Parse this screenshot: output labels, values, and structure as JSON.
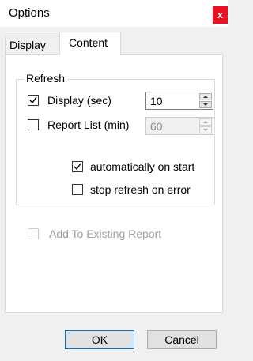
{
  "window": {
    "title": "Options",
    "close_glyph": "x"
  },
  "tabs": [
    {
      "label": "Display",
      "selected": false
    },
    {
      "label": "Content",
      "selected": true
    }
  ],
  "refresh": {
    "group_label": "Refresh",
    "display": {
      "label": "Display (sec)",
      "checked": true,
      "value": "10"
    },
    "report_list": {
      "label": "Report List (min)",
      "checked": false,
      "value": "60",
      "disabled": true
    },
    "auto_start": {
      "label": "automatically on start",
      "checked": true
    },
    "stop_on_error": {
      "label": "stop refresh on error",
      "checked": false
    }
  },
  "add_to_existing": {
    "label": "Add To Existing Report",
    "checked": false,
    "disabled": true
  },
  "buttons": {
    "ok": "OK",
    "cancel": "Cancel"
  },
  "colors": {
    "close_bg": "#e81123",
    "ok_border": "#0078d7"
  },
  "icons": {
    "close": "close-icon",
    "check": "checkmark-icon",
    "spin_up": "arrow-up-icon",
    "spin_down": "arrow-down-icon"
  }
}
